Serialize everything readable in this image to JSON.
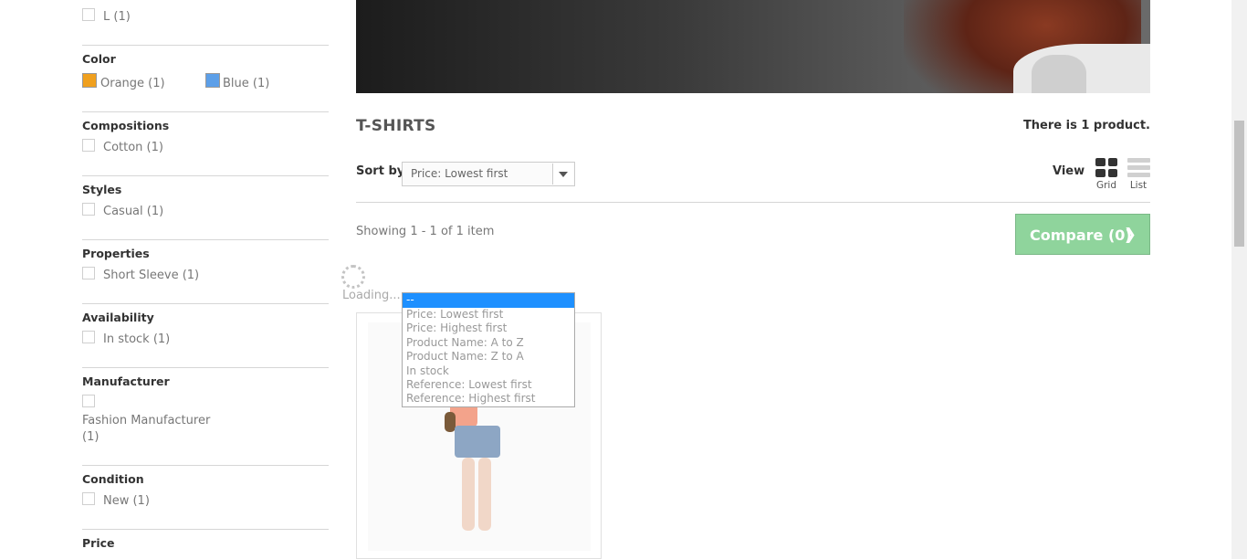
{
  "sidebar": {
    "size": {
      "option": "L (1)"
    },
    "color": {
      "title": "Color",
      "options": [
        {
          "label": "Orange (1)",
          "swatch": "#f0a01e"
        },
        {
          "label": "Blue (1)",
          "swatch": "#5c9fe8"
        }
      ]
    },
    "compositions": {
      "title": "Compositions",
      "option": "Cotton (1)"
    },
    "styles": {
      "title": "Styles",
      "option": "Casual (1)"
    },
    "properties": {
      "title": "Properties",
      "option": "Short Sleeve (1)"
    },
    "availability": {
      "title": "Availability",
      "option": "In stock (1)"
    },
    "manufacturer": {
      "title": "Manufacturer",
      "option_line1": "Fashion Manufacturer",
      "option_line2": "(1)"
    },
    "condition": {
      "title": "Condition",
      "option": "New (1)"
    },
    "price": {
      "title": "Price"
    }
  },
  "main": {
    "category_title": "T-SHIRTS",
    "product_count": "There is 1 product.",
    "sort": {
      "label": "Sort by",
      "selected": "Price: Lowest first"
    },
    "view": {
      "label": "View",
      "grid": "Grid",
      "list": "List"
    },
    "showing": "Showing 1 - 1 of 1 item",
    "compare_button": "Compare (0)",
    "loading": "Loading..."
  },
  "sort_dropdown": {
    "options": [
      "--",
      "Price: Lowest first",
      "Price: Highest first",
      "Product Name: A to Z",
      "Product Name: Z to A",
      "In stock",
      "Reference: Lowest first",
      "Reference: Highest first"
    ],
    "highlighted_index": 0
  },
  "colors": {
    "accent": "#1e90ff",
    "compare": "#8fd49c"
  },
  "icons": [
    "chevron-right-icon",
    "grid-view-icon",
    "list-view-icon",
    "dropdown-arrow-icon",
    "spinner-icon"
  ]
}
